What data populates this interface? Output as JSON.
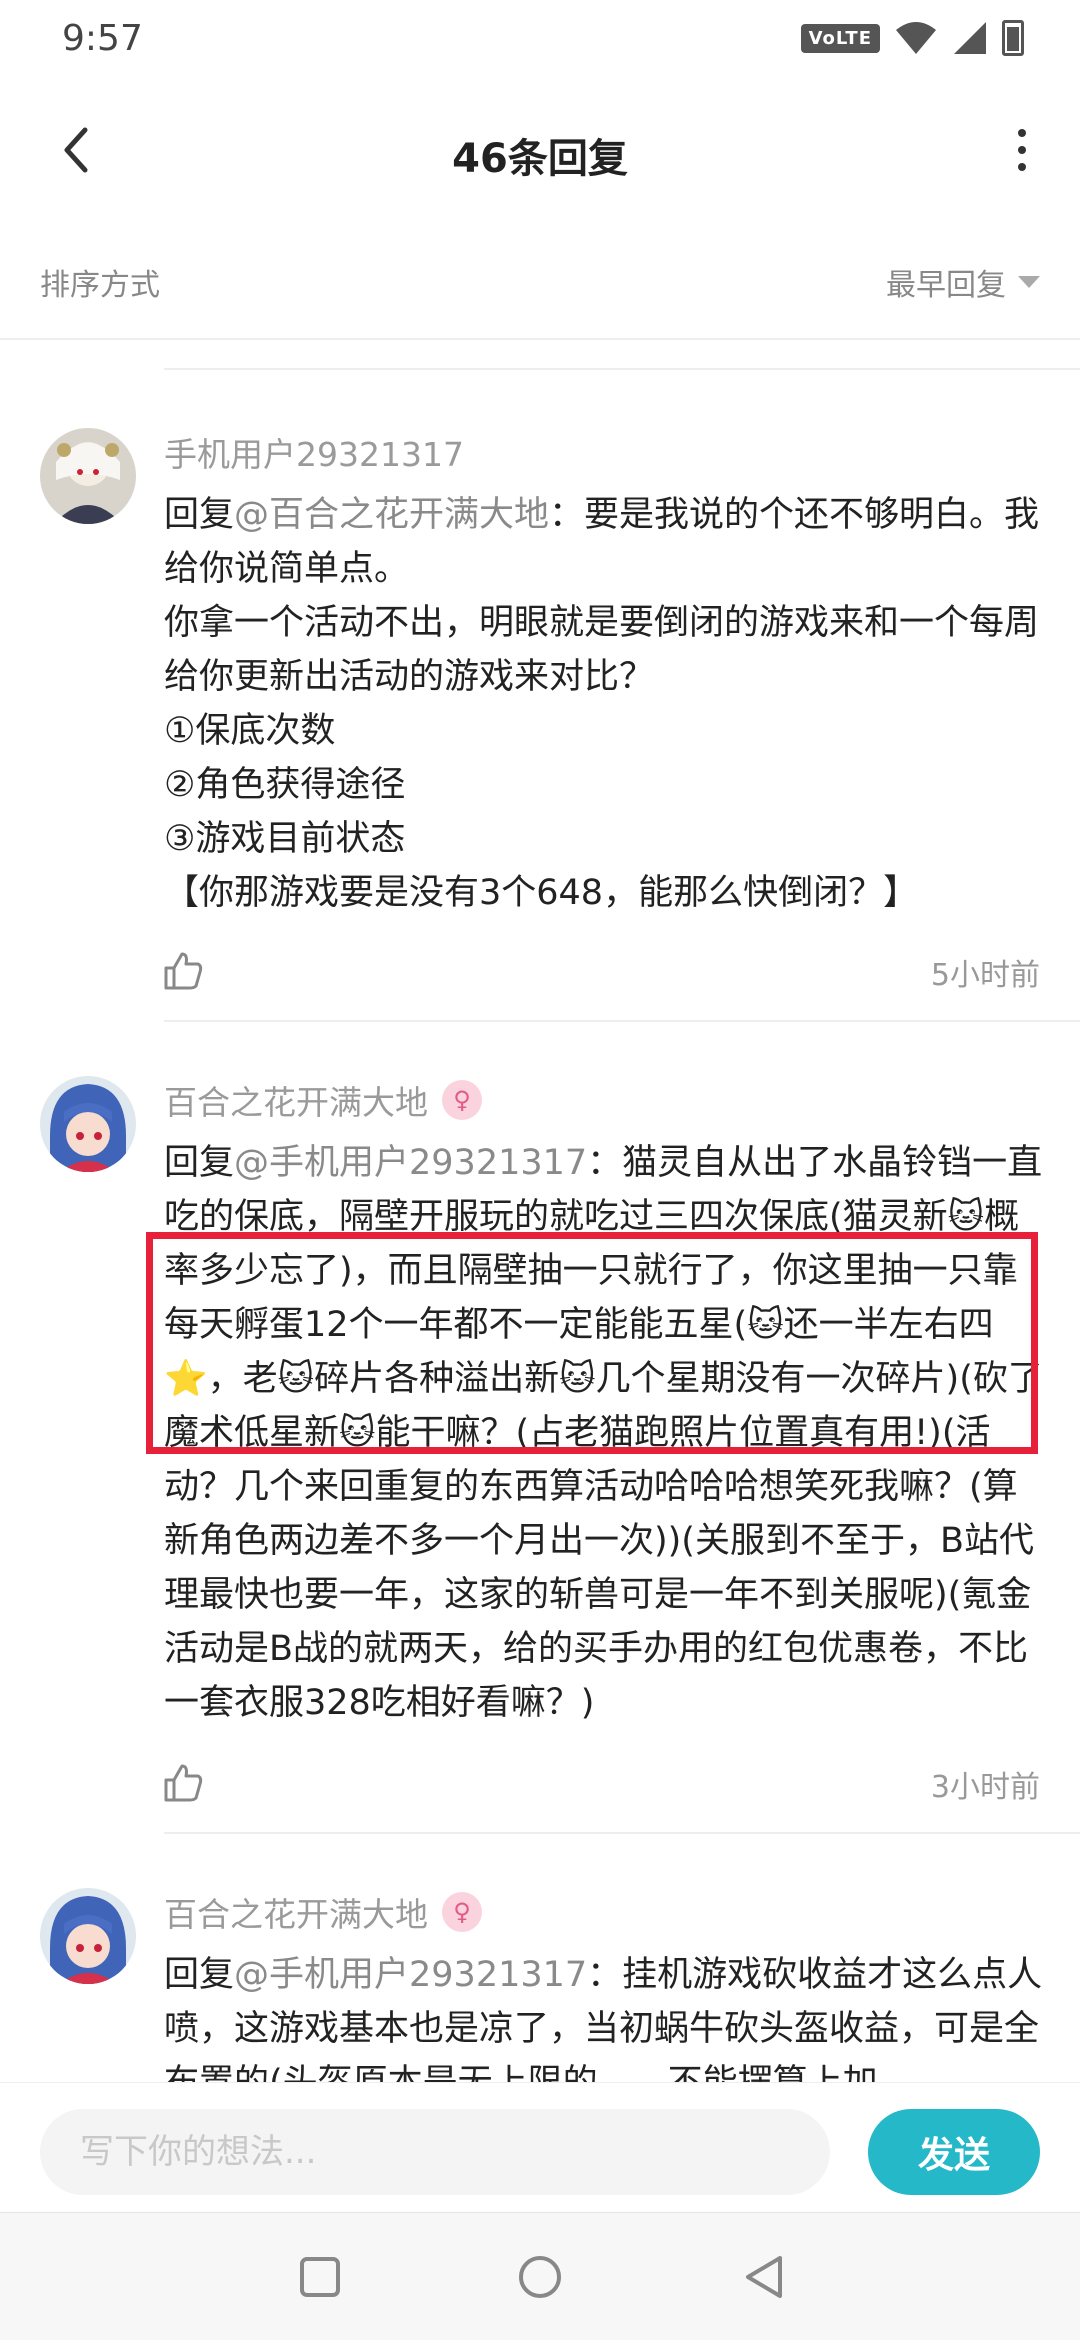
{
  "status_bar": {
    "time": "9:57",
    "network_badge": "VoLTE"
  },
  "header": {
    "title": "46条回复"
  },
  "sort": {
    "label": "排序方式",
    "value": "最早回复"
  },
  "comments": [
    {
      "username": "手机用户29321317",
      "reply_prefix": "回复",
      "mention": "@百合之花开满大地",
      "text": "：要是我说的个还不够明白。我给你说简单点。\n你拿一个活动不出，明眼就是要倒闭的游戏来和一个每周给你更新出活动的游戏来对比？\n①保底次数\n②角色获得途径\n③游戏目前状态\n【你那游戏要是没有3个648，能那么快倒闭？】",
      "time": "5小时前"
    },
    {
      "username": "百合之花开满大地",
      "reply_prefix": "回复",
      "mention": "@手机用户29321317",
      "text": "：猫灵自从出了水晶铃铛一直吃的保底，隔壁开服玩的就吃过三四次保底(猫灵新🐱概率多少忘了)，而且隔壁抽一只就行了，你这里抽一只靠每天孵蛋12个一年都不一定能能五星(🐱还一半左右四⭐，老🐱碎片各种溢出新🐱几个星期没有一次碎片)(砍了魔术低星新🐱能干嘛？(占老猫跑照片位置真有用!)(活动？几个来回重复的东西算活动哈哈哈想笑死我嘛？(算新角色两边差不多一个月出一次))(关服到不至于，B站代理最快也要一年，这家的斩兽可是一年不到关服呢)(氪金活动是B战的就两天，给的买手办用的红包优惠卷，不比一套衣服328吃相好看嘛？)",
      "time": "3小时前"
    },
    {
      "username": "百合之花开满大地",
      "reply_prefix": "回复",
      "mention": "@手机用户29321317",
      "text": "：挂机游戏砍收益才这么点人喷，这游戏基本也是凉了，当初蜗牛砍头盔收益，可是全布置的(头盔原本是无上限的……不能摆算上加"
    }
  ],
  "composer": {
    "placeholder": "写下你的想法...",
    "send_label": "发送"
  },
  "colors": {
    "accent": "#25b8c9",
    "highlight": "#e8213a",
    "muted": "#9a9a9a"
  },
  "icons": [
    "back-arrow-icon",
    "more-vert-icon",
    "thumbs-up-icon",
    "chevron-down-icon",
    "nav-square-icon",
    "nav-circle-icon",
    "nav-back-icon"
  ]
}
